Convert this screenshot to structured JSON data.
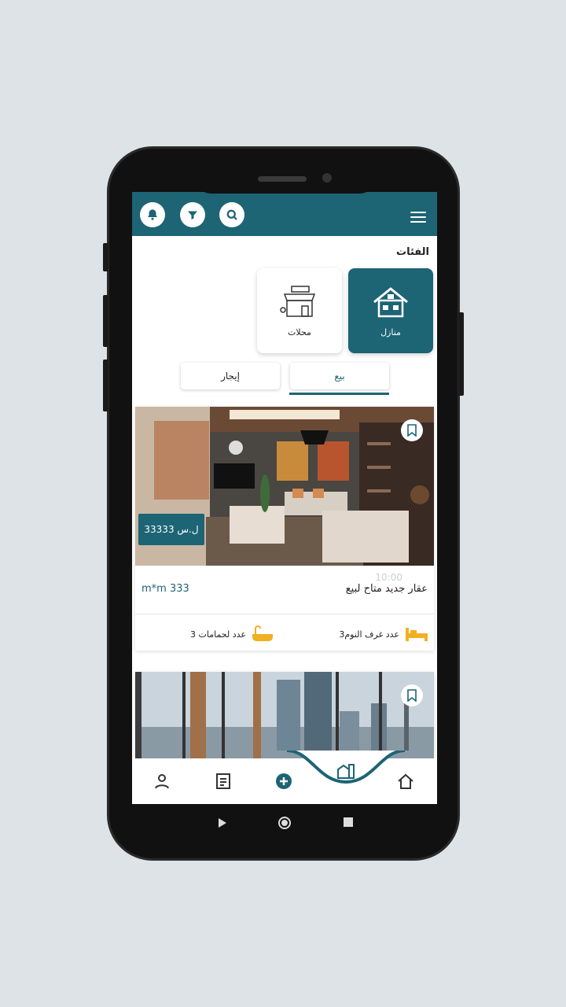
{
  "header": {
    "icons": [
      "notifications-icon",
      "filter-icon",
      "search-icon"
    ],
    "menu_icon": "menu-icon"
  },
  "categories": {
    "title": "الفئات",
    "items": [
      {
        "label": "منازل",
        "icon": "house-icon",
        "active": true
      },
      {
        "label": "محلات",
        "icon": "shop-icon",
        "active": false
      }
    ]
  },
  "tabs": {
    "sale": "بيع",
    "rent": "إيجار",
    "selected": "sale"
  },
  "listings": [
    {
      "price": "33333 ل.س",
      "title": "عقار جديد متاح لبيع",
      "area": "m*m 333",
      "time": "10:00",
      "bedrooms": "عدد غرف النوم3",
      "bathrooms": "عدد لحمامات 3"
    },
    {
      "price": "",
      "title": "",
      "area": ""
    }
  ],
  "bottom_nav": {
    "items": [
      "home-icon",
      "buildings-icon",
      "add-icon",
      "listings-icon",
      "profile-icon"
    ]
  },
  "colors": {
    "primary": "#1d6475",
    "accent": "#f0b020"
  }
}
